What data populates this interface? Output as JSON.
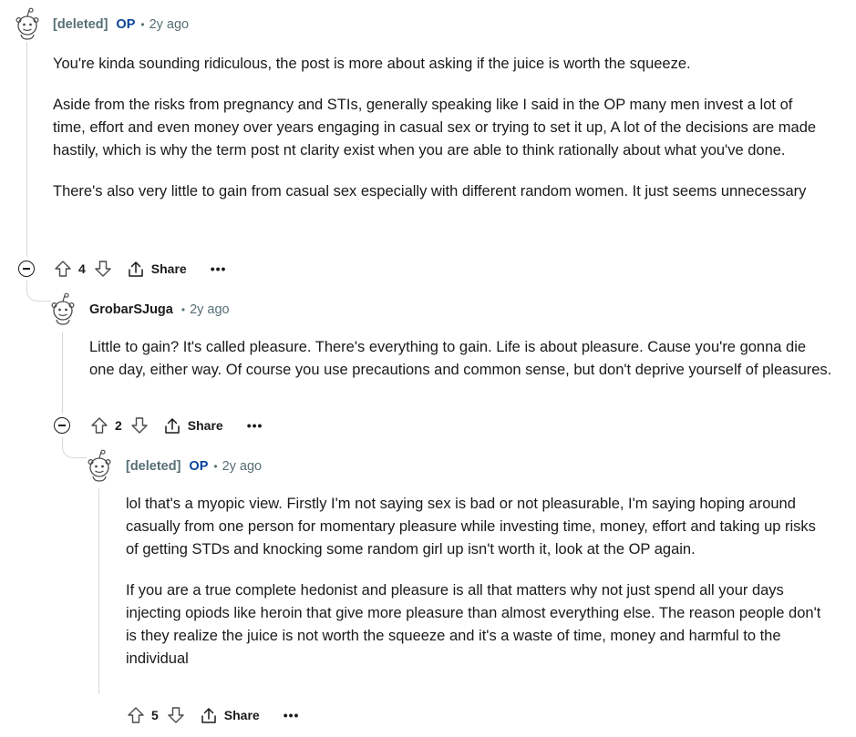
{
  "comments": [
    {
      "author": "[deleted]",
      "op_badge": "OP",
      "separator": "•",
      "time": "2y ago",
      "paragraphs": [
        "You're kinda sounding ridiculous, the post is more about asking if the juice is worth the squeeze.",
        "Aside from the risks from pregnancy and STIs, generally speaking like I said in the OP many men invest a lot of time, effort and even money over years engaging in casual sex or trying to set it up, A lot of the decisions are made hastily, which is why the term post nt clarity exist when you are able to think rationally about what you've done.",
        "There's also very little to gain from casual sex especially with different random women. It just seems unnecessary"
      ],
      "score": "4",
      "share_label": "Share",
      "more_label": "•••"
    },
    {
      "author": "GrobarSJuga",
      "separator": "•",
      "time": "2y ago",
      "paragraphs": [
        "Little to gain? It's called pleasure. There's everything to gain. Life is about pleasure. Cause you're gonna die one day, either way. Of course you use precautions and common sense, but don't deprive yourself of pleasures."
      ],
      "score": "2",
      "share_label": "Share",
      "more_label": "•••"
    },
    {
      "author": "[deleted]",
      "op_badge": "OP",
      "separator": "•",
      "time": "2y ago",
      "paragraphs": [
        "lol that's a myopic view. Firstly I'm not saying sex is bad or not pleasurable, I'm saying hoping around casually from one person for momentary pleasure while investing time, money, effort and taking up risks of getting STDs and knocking some random girl up isn't worth it, look at the OP again.",
        "If you are a true complete hedonist and pleasure is all that matters why not just spend all your days injecting opiods like heroin that give more pleasure than almost everything else. The reason people don't is they realize the juice is not worth the squeeze and it's a waste of time, money and harmful to the individual"
      ],
      "score": "5",
      "share_label": "Share",
      "more_label": "•••"
    }
  ],
  "icons": {
    "avatar": "snoo-avatar-icon",
    "upvote": "arrow-up-icon",
    "downvote": "arrow-down-icon",
    "share": "share-icon",
    "collapse": "collapse-minus-icon"
  },
  "colors": {
    "op_badge": "#0a449b",
    "muted": "#576f76",
    "text": "#1a1a1b",
    "thread_line": "#d7dadc"
  }
}
